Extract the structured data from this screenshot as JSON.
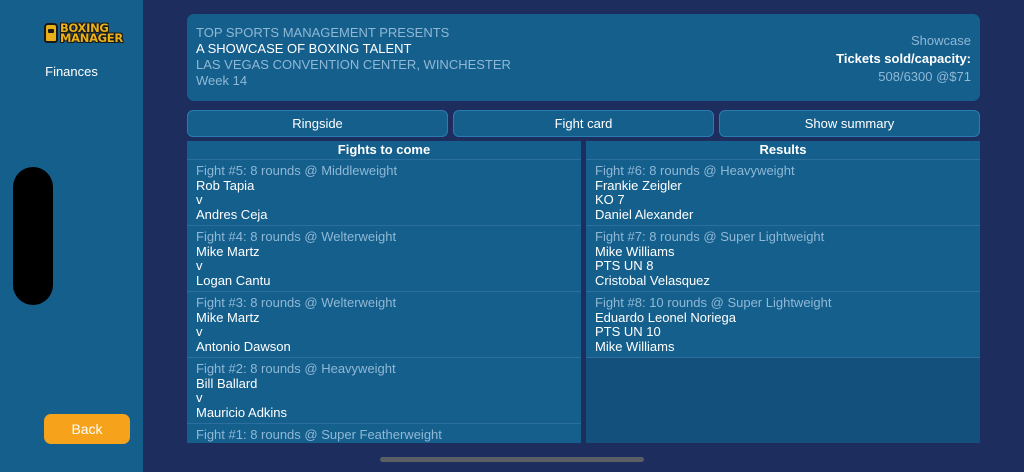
{
  "sidebar": {
    "logo": {
      "line1": "BOXING",
      "line2": "MANAGER"
    },
    "finances_label": "Finances",
    "back_label": "Back"
  },
  "header": {
    "presenter": "TOP SPORTS MANAGEMENT PRESENTS",
    "event_title": "A SHOWCASE OF BOXING TALENT",
    "venue": "LAS VEGAS CONVENTION CENTER, WINCHESTER",
    "week": "Week 14",
    "event_type": "Showcase",
    "tickets_label": "Tickets sold/capacity:",
    "tickets_value": "508/6300 @$71"
  },
  "tabs": [
    {
      "label": "Ringside"
    },
    {
      "label": "Fight card"
    },
    {
      "label": "Show summary"
    }
  ],
  "fights_to_come": {
    "heading": "Fights to come",
    "items": [
      {
        "title": "Fight #5: 8 rounds @ Middleweight",
        "fighter1": "Rob Tapia",
        "vs": "v",
        "fighter2": "Andres Ceja"
      },
      {
        "title": "Fight #4: 8 rounds @ Welterweight",
        "fighter1": "Mike Martz",
        "vs": "v",
        "fighter2": "Logan Cantu"
      },
      {
        "title": "Fight #3: 8 rounds @ Welterweight",
        "fighter1": "Mike Martz",
        "vs": "v",
        "fighter2": "Antonio Dawson"
      },
      {
        "title": "Fight #2: 8 rounds @ Heavyweight",
        "fighter1": "Bill Ballard",
        "vs": "v",
        "fighter2": "Mauricio Adkins"
      },
      {
        "title": "Fight #1: 8 rounds @ Super Featherweight"
      }
    ]
  },
  "results": {
    "heading": "Results",
    "items": [
      {
        "title": "Fight #6: 8 rounds @ Heavyweight",
        "winner": "Frankie Zeigler",
        "outcome": "KO 7",
        "loser": "Daniel Alexander"
      },
      {
        "title": "Fight #7: 8 rounds @ Super Lightweight",
        "winner": "Mike Williams",
        "outcome": "PTS UN 8",
        "loser": "Cristobal Velasquez"
      },
      {
        "title": "Fight #8: 10 rounds @ Super Lightweight",
        "winner": "Eduardo Leonel Noriega",
        "outcome": "PTS UN 10",
        "loser": "Mike Williams"
      }
    ]
  },
  "colors": {
    "background": "#1c2d5e",
    "panel": "#155f8c",
    "accent_button": "#f7a21b",
    "muted_text": "#8fb8d6"
  }
}
